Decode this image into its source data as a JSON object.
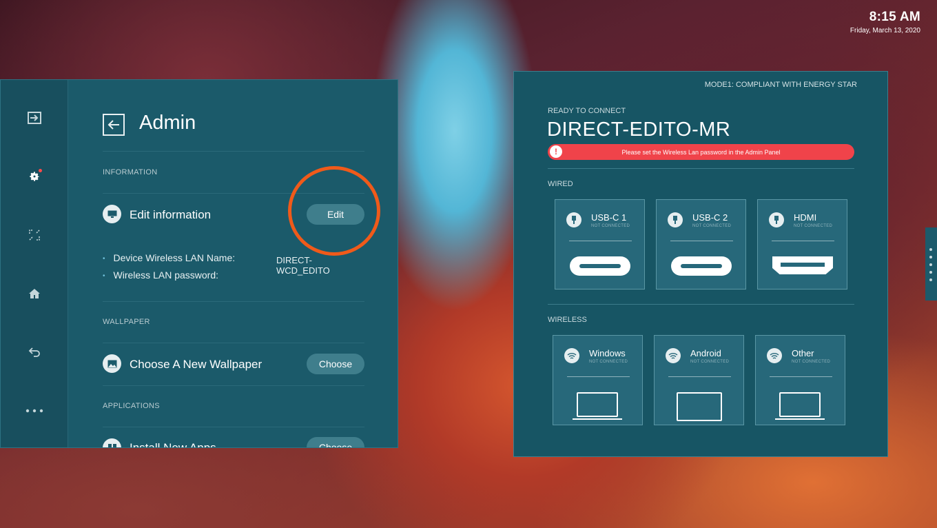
{
  "clock": {
    "time": "8:15 AM",
    "date": "Friday, March 13, 2020"
  },
  "admin": {
    "title": "Admin",
    "sections": {
      "information": "INFORMATION",
      "wallpaper": "WALLPAPER",
      "applications": "APPLICATIONS"
    },
    "edit_info": {
      "label": "Edit information",
      "button": "Edit"
    },
    "details": [
      {
        "label": "Device Wireless LAN Name:",
        "value": "DIRECT-WCD_EDITO"
      },
      {
        "label": "Wireless LAN password:",
        "value": ""
      }
    ],
    "wallpaper_row": {
      "label": "Choose A New Wallpaper",
      "button": "Choose"
    },
    "apps_row": {
      "label": "Install New Apps",
      "button": "Choose"
    }
  },
  "connect": {
    "mode": "MODE1: COMPLIANT WITH ENERGY STAR",
    "ready": "READY TO CONNECT",
    "device_name": "DIRECT-EDITO-MR",
    "alert": "Please set the Wireless Lan password in the Admin Panel",
    "wired_label": "WIRED",
    "wireless_label": "WIRELESS",
    "wired": [
      {
        "name": "USB-C 1",
        "status": "NOT CONNECTED"
      },
      {
        "name": "USB-C 2",
        "status": "NOT CONNECTED"
      },
      {
        "name": "HDMI",
        "status": "NOT CONNECTED"
      }
    ],
    "wireless": [
      {
        "name": "Windows",
        "status": "NOT CONNECTED"
      },
      {
        "name": "Android",
        "status": "NOT CONNECTED"
      },
      {
        "name": "Other",
        "status": "NOT CONNECTED"
      }
    ]
  },
  "colors": {
    "panel": "#1b5a6a",
    "accent_ring": "#f05a1a",
    "alert": "#f0434a"
  }
}
